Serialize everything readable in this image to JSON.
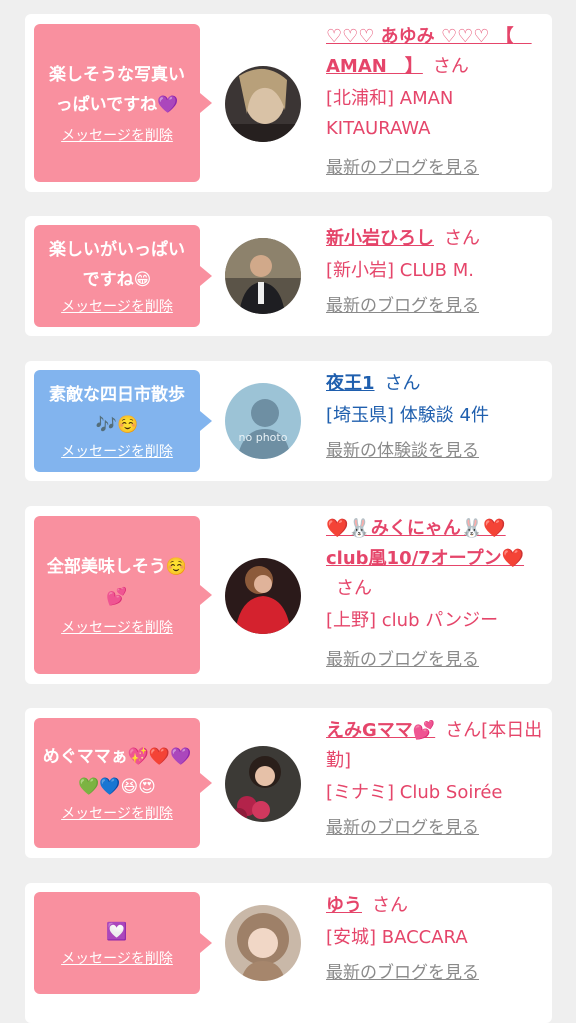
{
  "items": [
    {
      "message": "楽しそうな写真いっぱいですね💜",
      "delete_label": "メッセージを削除",
      "name": "♡♡♡ あゆみ ♡♡♡ 【　AMAN　】",
      "suffix": "さん",
      "shop": "[北浦和] AMAN KITAURAWA",
      "link": "最新のブログを見る",
      "avatar_icon": "woman-photo"
    },
    {
      "message": "楽しいがいっぱいですね😁",
      "delete_label": "メッセージを削除",
      "name": "新小岩ひろし",
      "suffix": "さん",
      "shop": "[新小岩] CLUB M.",
      "link": "最新のブログを見る",
      "avatar_icon": "man-photo"
    },
    {
      "message": "素敵な四日市散歩🎶☺️",
      "delete_label": "メッセージを削除",
      "name": "夜王1",
      "suffix": "さん",
      "shop": "[埼玉県] 体験談 4件",
      "link": "最新の体験談を見る",
      "avatar_icon": "no-photo",
      "avatar_text": "no photo"
    },
    {
      "message": "全部美味しそう☺️💕",
      "delete_label": "メッセージを削除",
      "name": "❤️🐰みくにゃん🐰❤️club凰10/7オープン❤️",
      "suffix": "さん",
      "shop": "[上野] club パンジー",
      "link": "最新のブログを見る",
      "avatar_icon": "woman-red-dress-photo"
    },
    {
      "message": "めぐママぁ💖❤️💜💚💙😆😍",
      "delete_label": "メッセージを削除",
      "name": "えみGママ💕",
      "suffix": "さん[本日出勤]",
      "shop": "[ミナミ] Club Soirée",
      "link": "最新のブログを見る",
      "avatar_icon": "woman-flowers-photo"
    },
    {
      "message": "💟",
      "delete_label": "メッセージを削除",
      "name": "ゆう",
      "suffix": "さん",
      "shop": "[安城] BACCARA",
      "link": "最新のブログを見る",
      "avatar_icon": "woman-hood-photo"
    }
  ],
  "colors": {
    "pink_bubble": "#f9909f",
    "blue_bubble": "#82b4ee",
    "pink_text": "#e5456a",
    "blue_text": "#1f5fae",
    "link_gray": "#8a8a8a"
  }
}
